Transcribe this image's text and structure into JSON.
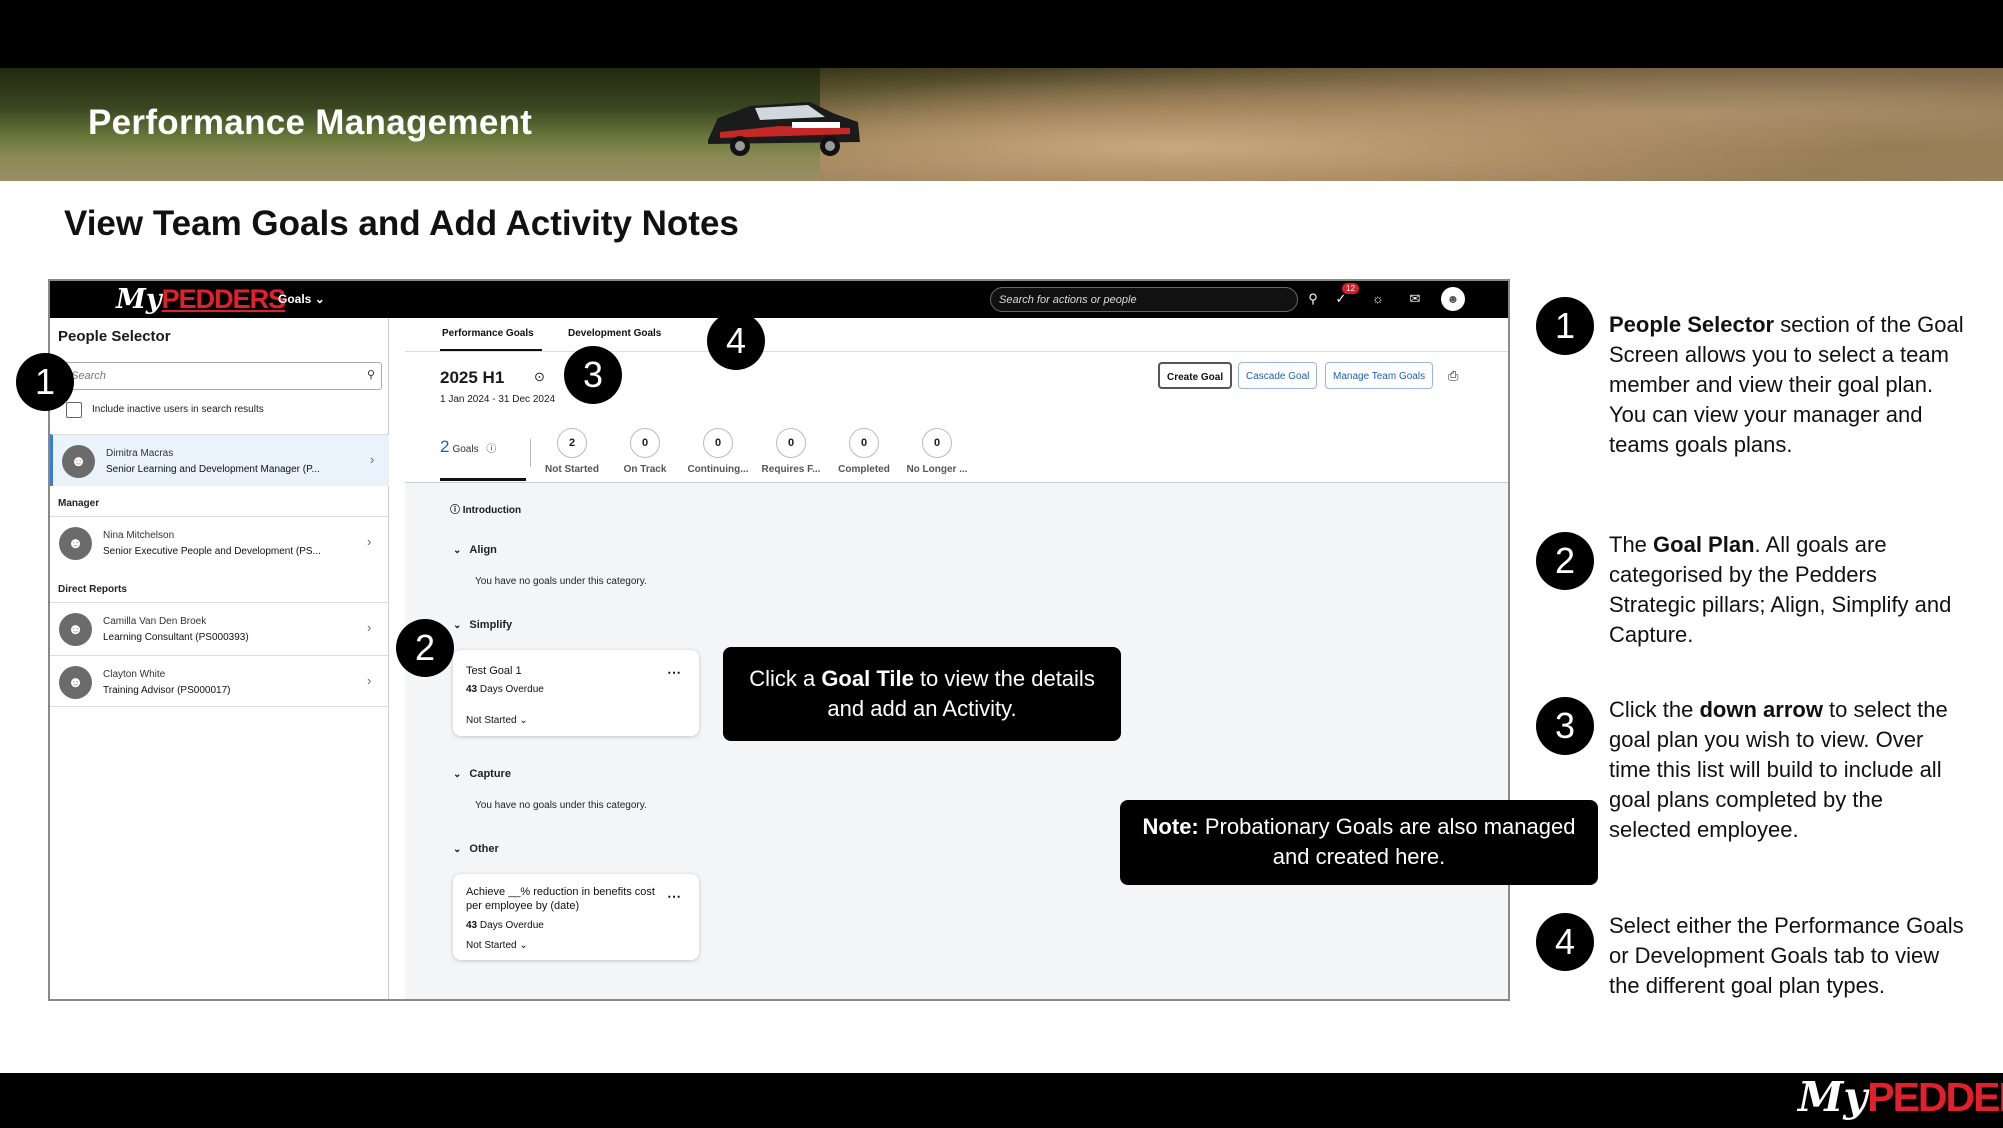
{
  "header": {
    "title": "Performance Management"
  },
  "slide": {
    "title": "View Team Goals and Add Activity Notes"
  },
  "app": {
    "logo_my": "My",
    "logo_pedders": "PEDDERS",
    "nav_goals": "Goals",
    "search_placeholder": "Search for actions or people",
    "notification_count": "12"
  },
  "people_selector": {
    "title": "People Selector",
    "search_placeholder": "Search",
    "include_inactive": "Include inactive users in search results",
    "selected": {
      "name": "Dimitra Macras",
      "role": "Senior Learning and Development Manager (P..."
    },
    "manager_label": "Manager",
    "manager": {
      "name": "Nina Mitchelson",
      "role": "Senior Executive People and Development (PS..."
    },
    "direct_reports_label": "Direct Reports",
    "direct_reports": [
      {
        "name": "Camilla Van Den Broek",
        "role": "Learning Consultant (PS000393)"
      },
      {
        "name": "Clayton White",
        "role": "Training Advisor (PS000017)"
      }
    ]
  },
  "goal_tabs": [
    "Performance Goals",
    "Development Goals"
  ],
  "plan": {
    "title": "2025 H1",
    "dates": "1 Jan 2024 - 31 Dec 2024",
    "buttons": {
      "create": "Create Goal",
      "cascade": "Cascade Goal",
      "manage": "Manage Team Goals"
    }
  },
  "stats": {
    "goals_count": "2",
    "goals_label": "Goals",
    "items": [
      {
        "value": "2",
        "label": "Not Started"
      },
      {
        "value": "0",
        "label": "On Track"
      },
      {
        "value": "0",
        "label": "Continuing..."
      },
      {
        "value": "0",
        "label": "Requires F..."
      },
      {
        "value": "0",
        "label": "Completed"
      },
      {
        "value": "0",
        "label": "No Longer ..."
      }
    ]
  },
  "categories": {
    "intro": "Introduction",
    "align": "Align",
    "simplify": "Simplify",
    "capture": "Capture",
    "other": "Other",
    "no_goals": "You have no goals under this category."
  },
  "tiles": [
    {
      "title": "Test Goal 1",
      "overdue_days": "43",
      "overdue_text": "Days Overdue",
      "status": "Not Started"
    },
    {
      "title": "Achieve __% reduction in benefits cost per employee by (date)",
      "overdue_days": "43",
      "overdue_text": "Days Overdue",
      "status": "Not Started"
    }
  ],
  "callouts": {
    "goal_tile_pre": "Click a ",
    "goal_tile_bold": "Goal Tile",
    "goal_tile_post": " to view the details and add an Activity.",
    "note_bold": "Note:",
    "note_text": " Probationary Goals are also managed and created here."
  },
  "markers": [
    "1",
    "2",
    "3",
    "4"
  ],
  "instructions": [
    {
      "num": "1",
      "bold": "People Selector",
      "text": " section of the Goal Screen allows you to select a team member and view their goal plan. You can view your manager and teams goals plans."
    },
    {
      "num": "2",
      "pre": "The ",
      "bold": "Goal Plan",
      "text": ". All goals are categorised by the Pedders Strategic pillars; Align, Simplify and Capture."
    },
    {
      "num": "3",
      "pre": "Click the ",
      "bold": "down arrow",
      "text": " to select the goal plan you wish to view. Over time this list will build to include all goal plans completed by the selected employee."
    },
    {
      "num": "4",
      "text": "Select either the Performance Goals or Development Goals tab to view the different goal plan types."
    }
  ],
  "footer": {
    "logo_my": "My",
    "logo_pedders": "PEDDERS"
  },
  "colors": {
    "brand_red": "#e0202a",
    "accent_blue": "#1d5fb8",
    "dark": "#000000"
  }
}
